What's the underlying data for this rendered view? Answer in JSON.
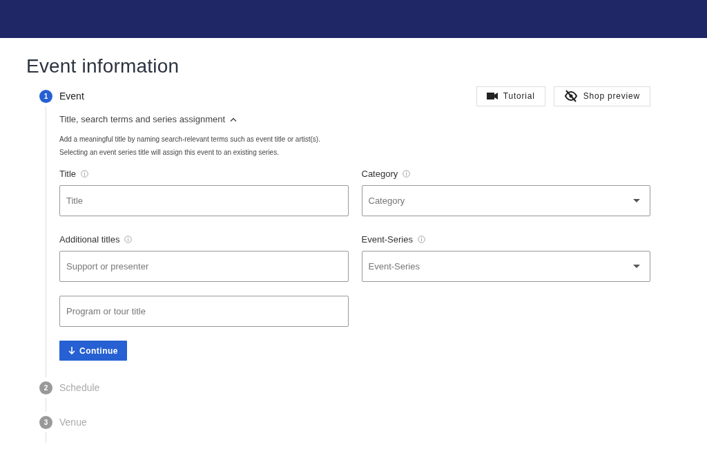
{
  "page": {
    "title": "Event information"
  },
  "actions": [
    {
      "kind": "video",
      "label": "Tutorial"
    },
    {
      "kind": "eye-off",
      "label": "Shop preview"
    }
  ],
  "steps": [
    {
      "number": "1",
      "label": "Event",
      "active": true
    },
    {
      "number": "2",
      "label": "Schedule",
      "active": false
    },
    {
      "number": "3",
      "label": "Venue",
      "active": false
    }
  ],
  "section": {
    "title": "Title, search terms and series assignment",
    "expanded": true,
    "description": [
      "Add a meaningful title by naming search-relevant terms such as event title or artist(s).",
      "Selecting an event series title will assign this event to an existing series."
    ],
    "columns": [
      {
        "groups": [
          {
            "label": "Title",
            "inputs": [
              {
                "kind": "text",
                "placeholder": "Title"
              }
            ]
          },
          {
            "label": "Additional titles",
            "inputs": [
              {
                "kind": "text",
                "placeholder": "Support or presenter"
              },
              {
                "kind": "text",
                "placeholder": "Program or tour title"
              }
            ]
          }
        ]
      },
      {
        "groups": [
          {
            "label": "Category",
            "inputs": [
              {
                "kind": "select",
                "placeholder": "Category"
              }
            ]
          },
          {
            "label": "Event-Series",
            "inputs": [
              {
                "kind": "select",
                "placeholder": "Event-Series"
              }
            ]
          }
        ]
      }
    ],
    "button": "Continue"
  }
}
